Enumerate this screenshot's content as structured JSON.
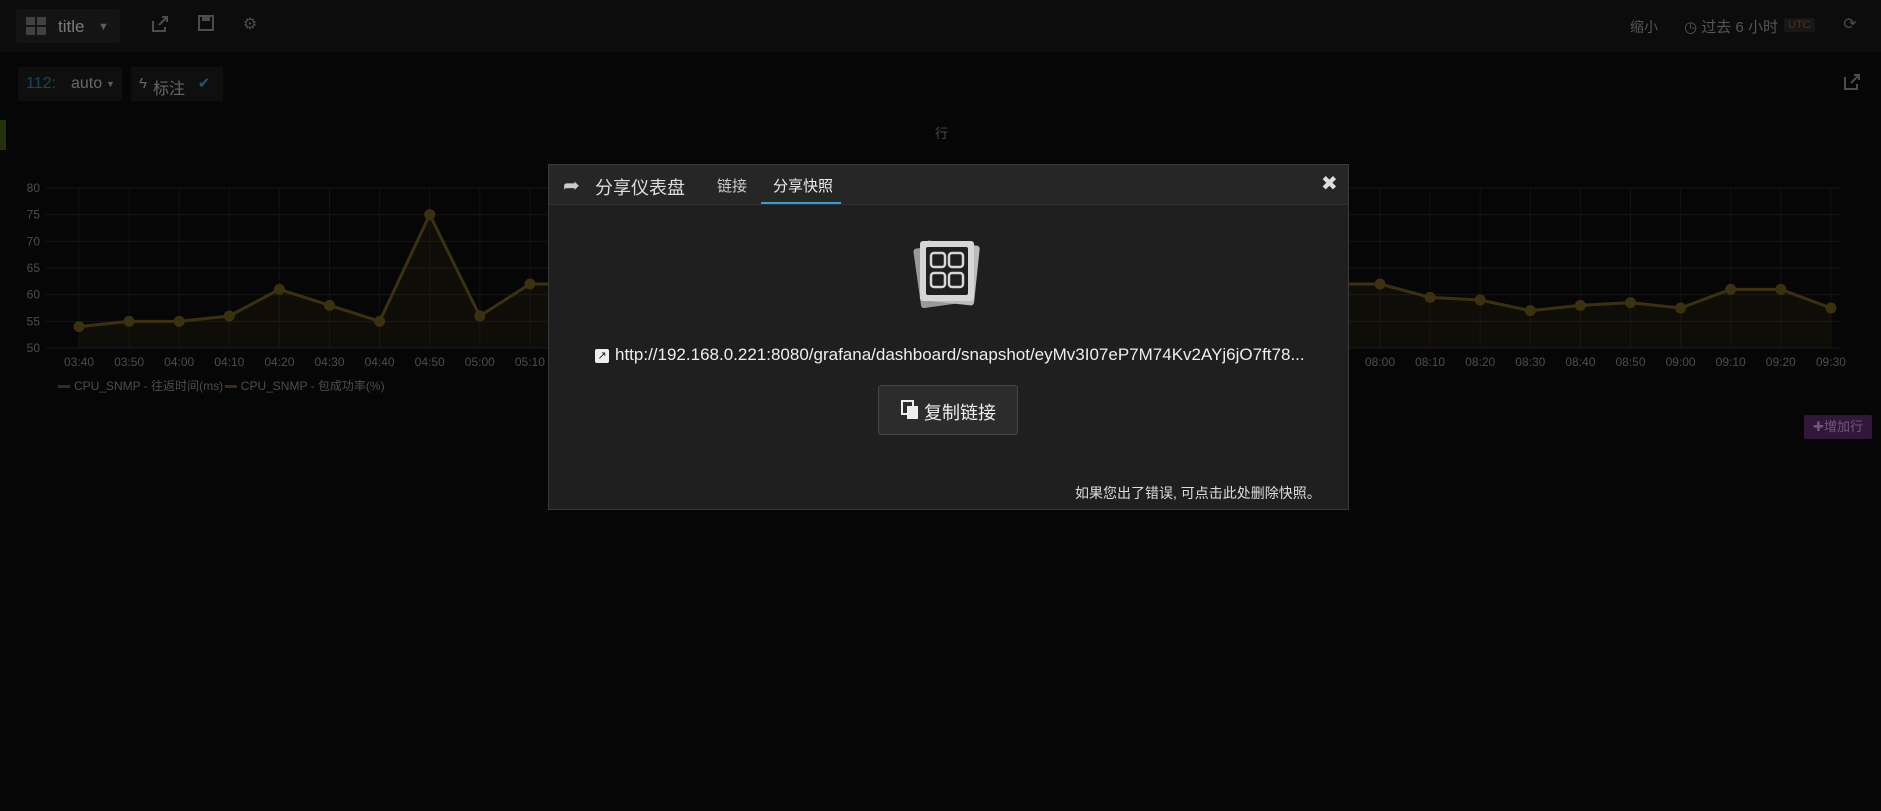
{
  "navbar": {
    "dashboard_title": "title",
    "zoom_out": "缩小",
    "time_range": "过去 6 小时",
    "timezone": "UTC",
    "icons": [
      "grid-icon",
      "share-icon",
      "save-icon",
      "gear-icon",
      "clock-icon",
      "refresh-icon"
    ]
  },
  "submenu": {
    "variable_label": "112:",
    "variable_value": "auto",
    "annotation_label": "标注"
  },
  "panel": {
    "row_title": "行",
    "add_row": "增加行"
  },
  "chart_data": {
    "type": "line",
    "x": [
      "03:40",
      "03:50",
      "04:00",
      "04:10",
      "04:20",
      "04:30",
      "04:40",
      "04:50",
      "05:00",
      "05:10",
      "08:00",
      "08:10",
      "08:20",
      "08:30",
      "08:40",
      "08:50",
      "09:00",
      "09:10",
      "09:20",
      "09:30"
    ],
    "x_ticks": [
      "03:40",
      "03:50",
      "04:00",
      "04:10",
      "04:20",
      "04:30",
      "04:40",
      "04:50",
      "05:00",
      "05:10",
      "08:00",
      "08:10",
      "08:20",
      "08:30",
      "08:40",
      "08:50",
      "09:00",
      "09:10",
      "09:20",
      "09:30"
    ],
    "y_ticks": [
      "80",
      "75",
      "70",
      "65",
      "60",
      "55",
      "50"
    ],
    "ylim": [
      50,
      80
    ],
    "series": [
      {
        "name": "CPU_SNMP - 往返时间(ms)",
        "values": []
      },
      {
        "name": "CPU_SNMP - 包成功率(%)",
        "values": [
          54,
          55,
          55,
          56,
          61,
          58,
          55,
          75,
          56,
          62,
          62,
          59.5,
          59,
          57,
          58,
          58.5,
          57.5,
          61,
          61,
          57.5
        ]
      }
    ],
    "colors": {
      "series_1": "#3f6b2a",
      "series_2": "#6e5a1a"
    },
    "grid": true,
    "legend": "bottom-left"
  },
  "modal": {
    "title": "分享仪表盘",
    "tab_link": "链接",
    "tab_snapshot": "分享快照",
    "snapshot_url": "http://192.168.0.221:8080/grafana/dashboard/snapshot/eyMv3I07eP7M74Kv2AYj6jO7ft78...",
    "copy_button": "复制链接",
    "delete_note": "如果您出了错误, 可点击此处删除快照。"
  }
}
